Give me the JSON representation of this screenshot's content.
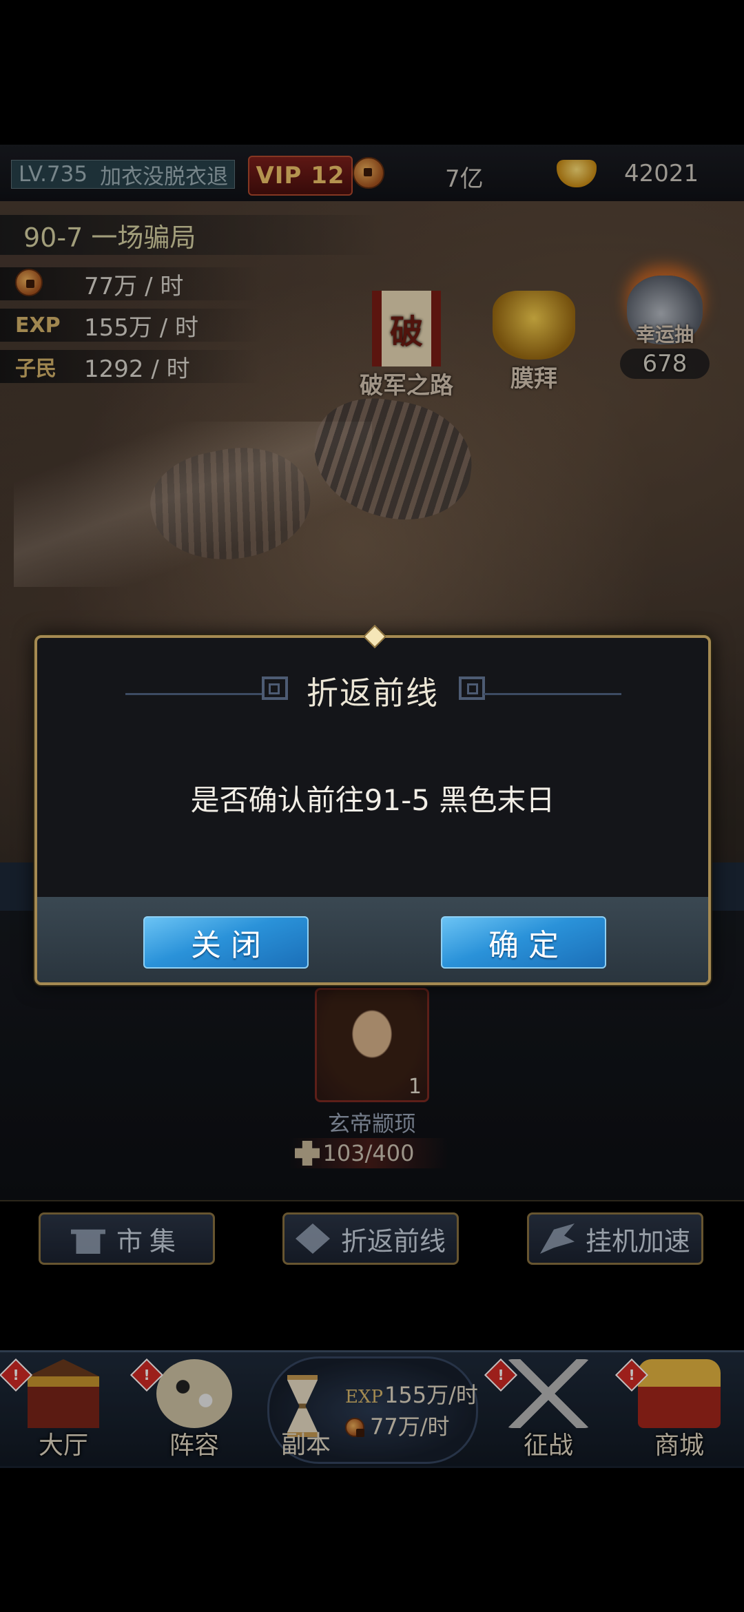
{
  "topbar": {
    "level": "LV.735",
    "player_name": "加衣没脱衣退",
    "vip": "VIP 12",
    "copper": "7亿",
    "gold": "42021",
    "icons": {
      "copper": "copper-coin-icon",
      "gold": "gold-ingot-icon"
    }
  },
  "stage": {
    "title": "90-7 一场骗局",
    "rates": [
      {
        "label": "",
        "icon": "copper-coin-icon",
        "value": "77万 / 时"
      },
      {
        "label": "EXP",
        "value": "155万 / 时"
      },
      {
        "label": "子民",
        "value": "1292 / 时"
      }
    ]
  },
  "map_icons": {
    "pojun": {
      "label": "破军之路",
      "glyph": "破"
    },
    "mobai": {
      "label": "膜拜"
    },
    "lucky": {
      "label": "幸运抽",
      "count": "678"
    }
  },
  "hero": {
    "name": "玄帝颛顼",
    "level": "1",
    "fragments": "103/400"
  },
  "actions": {
    "market": "市集",
    "return_front": "折返前线",
    "speed_up": "挂机加速"
  },
  "nav": {
    "hall": "大厅",
    "lineup": "阵容",
    "dungeon": "副本",
    "dungeon_exp_label": "EXP",
    "dungeon_exp_rate": "155万/时",
    "dungeon_coin_rate": "77万/时",
    "campaign": "征战",
    "shop": "商城",
    "badge": "!"
  },
  "dialog": {
    "title": "折返前线",
    "message": "是否确认前往91-5 黑色末日",
    "close_label": "关闭",
    "confirm_label": "确定"
  },
  "colors": {
    "accent_gold": "#a58a52",
    "button_blue": "#2a92d9",
    "badge_red": "#d12a24"
  }
}
